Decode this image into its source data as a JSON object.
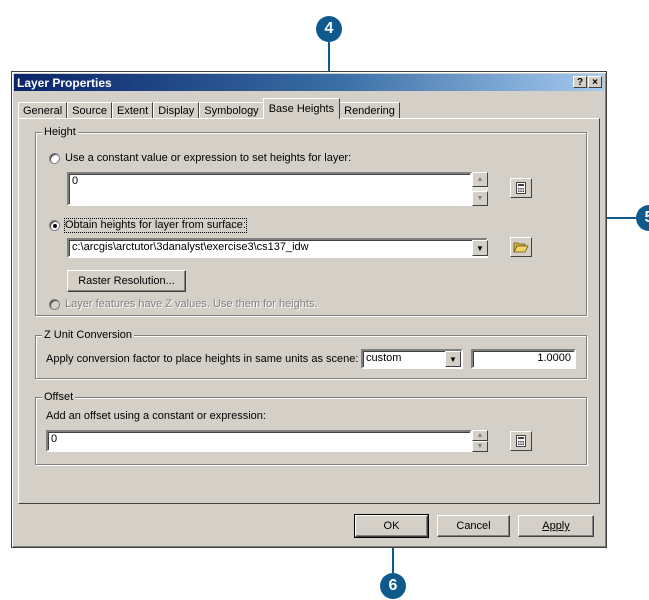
{
  "callouts": {
    "step4": "4",
    "step5": "5",
    "step6": "6"
  },
  "window": {
    "title": "Layer Properties",
    "help_glyph": "?",
    "close_glyph": "×"
  },
  "tabs": [
    {
      "label": "General"
    },
    {
      "label": "Source"
    },
    {
      "label": "Extent"
    },
    {
      "label": "Display"
    },
    {
      "label": "Symbology"
    },
    {
      "label": "Base Heights",
      "active": true
    },
    {
      "label": "Rendering"
    }
  ],
  "height_group": {
    "title": "Height",
    "option_constant": "Use a constant value or expression to set heights for layer:",
    "constant_value": "0",
    "option_surface": "Obtain heights for layer from surface:",
    "surface_path": "c:\\arcgis\\arctutor\\3danalyst\\exercise3\\cs137_idw",
    "raster_resolution_button": "Raster Resolution...",
    "option_z_values": "Layer features have Z values.  Use them for heights."
  },
  "z_group": {
    "title": "Z Unit Conversion",
    "label": "Apply conversion factor to place heights in same units as scene:",
    "unit_selected": "custom",
    "factor": "1.0000"
  },
  "offset_group": {
    "title": "Offset",
    "label": "Add an offset using a constant or expression:",
    "value": "0"
  },
  "buttons": {
    "ok": "OK",
    "cancel": "Cancel",
    "apply": "Apply"
  },
  "icons": {
    "calculator": "calculator-icon",
    "folder": "open-folder-icon",
    "arrow_up": "arrow-up-icon",
    "arrow_down": "arrow-down-icon",
    "dropdown": "chevron-down-icon"
  },
  "colors": {
    "callout": "#0f5a8c",
    "dialog_face": "#d4d0c8",
    "title_start": "#0a246a",
    "title_end": "#a6caf0"
  }
}
